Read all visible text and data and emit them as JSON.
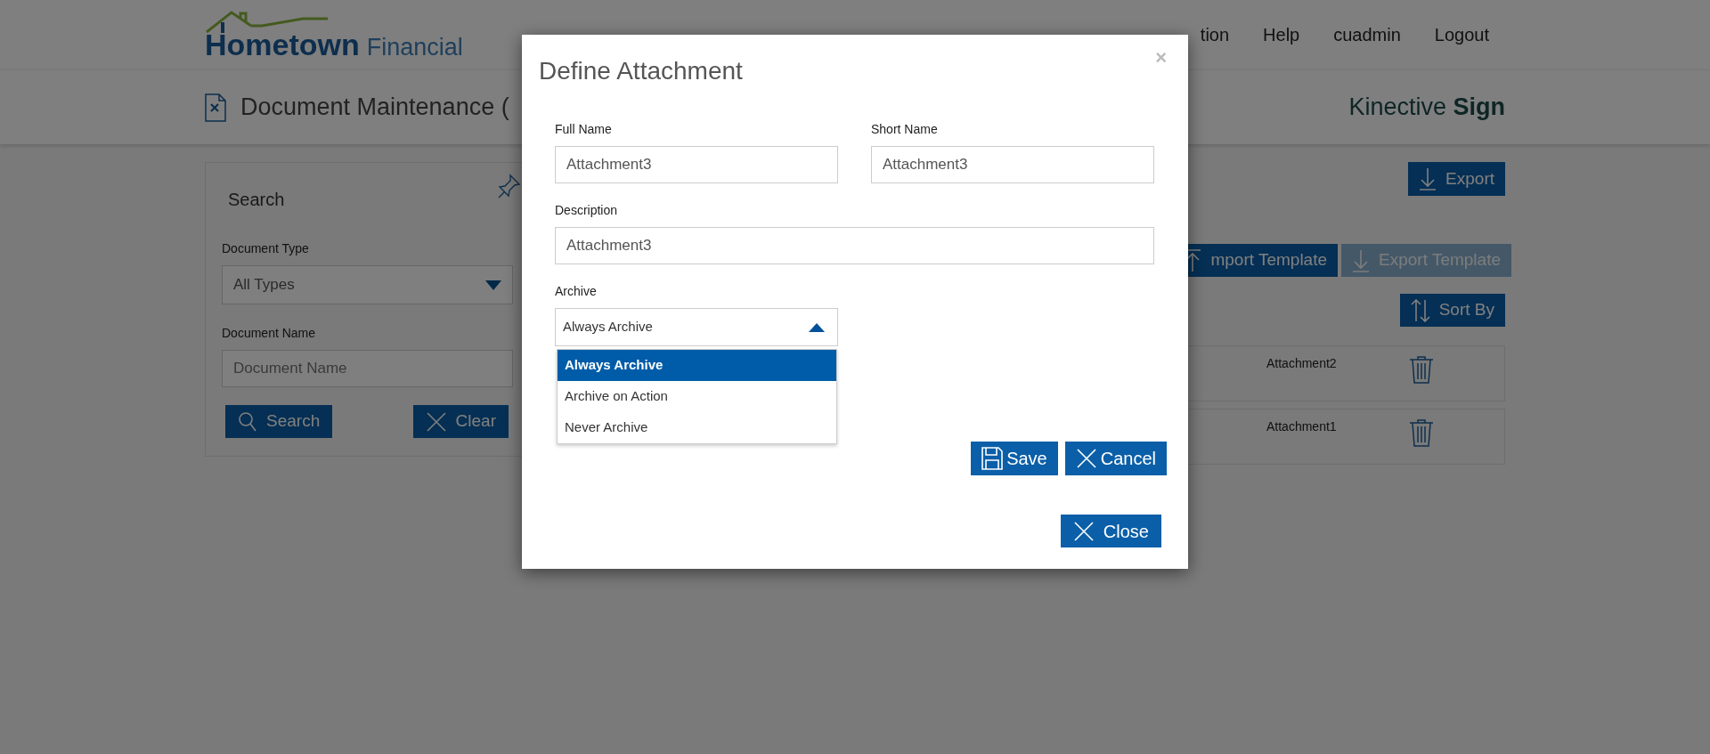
{
  "header": {
    "logo": {
      "name": "Hometown",
      "suffix": "Financial"
    },
    "nav": [
      {
        "label": "tion"
      },
      {
        "label": "Help"
      },
      {
        "label": "cuadmin"
      },
      {
        "label": "Logout"
      }
    ]
  },
  "page_title": "Document Maintenance (",
  "product": "Kinective **Sign**",
  "search_panel": {
    "title": "Search",
    "fields": [
      {
        "kind": "select",
        "label": "Document Type",
        "value": "All Types"
      },
      {
        "kind": "text",
        "label": "Document Name",
        "placeholder": "Document Name"
      }
    ],
    "buttons": [
      {
        "kind": "search",
        "label": "Search"
      },
      {
        "kind": "clear",
        "label": "Clear"
      }
    ]
  },
  "export_button": {
    "kind": "export",
    "label": "Export"
  },
  "template_buttons": [
    {
      "kind": "import",
      "label": "mport Template",
      "disabled": false
    },
    {
      "kind": "export",
      "label": "Export Template",
      "disabled": true
    }
  ],
  "sort_button": {
    "kind": "sort",
    "label": "Sort By"
  },
  "documents": [
    {
      "name": "Attachment2"
    },
    {
      "name": "Attachment1"
    }
  ],
  "dialog": {
    "title": "Define Attachment",
    "close_symbol": "×",
    "fields": [
      {
        "label": "Full Name",
        "value": "Attachment3"
      },
      {
        "label": "Short Name",
        "value": "Attachment3"
      },
      {
        "label": "Description",
        "value": "Attachment3"
      }
    ],
    "archive": {
      "label": "Archive",
      "value": "Always Archive",
      "expanded": true,
      "options": [
        {
          "label": "Always Archive",
          "selected": true
        },
        {
          "label": "Archive on Action",
          "selected": false
        },
        {
          "label": "Never Archive",
          "selected": false
        }
      ]
    },
    "actions": [
      {
        "kind": "save",
        "label": "Save"
      },
      {
        "kind": "cancel",
        "label": "Cancel"
      }
    ],
    "footer_buttons": [
      {
        "kind": "close",
        "label": "Close"
      }
    ]
  }
}
